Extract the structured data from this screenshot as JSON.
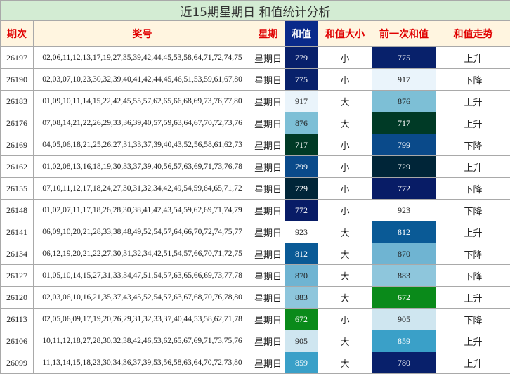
{
  "title": "近15期星期日 和值统计分析",
  "headers": [
    "期次",
    "奖号",
    "星期",
    "和值",
    "和值大小",
    "前一次和值",
    "和值走势"
  ],
  "rows": [
    {
      "period": "26197",
      "numbers": "02,06,11,12,13,17,19,27,35,39,42,44,45,53,58,64,71,72,74,75",
      "weekday": "星期日",
      "sum": "779",
      "sum_color": "#08206b",
      "size": "小",
      "prev": "775",
      "prev_color": "#08216b",
      "trend": "上升"
    },
    {
      "period": "26190",
      "numbers": "02,03,07,10,23,30,32,39,40,41,42,44,45,46,51,53,59,61,67,80",
      "weekday": "星期日",
      "sum": "775",
      "sum_color": "#08216b",
      "size": "小",
      "prev": "917",
      "prev_color": "#eaf4fb",
      "trend": "下降"
    },
    {
      "period": "26183",
      "numbers": "01,09,10,11,14,15,22,42,45,55,57,62,65,66,68,69,73,76,77,80",
      "weekday": "星期日",
      "sum": "917",
      "sum_color": "#eaf4fb",
      "size": "大",
      "prev": "876",
      "prev_color": "#7dbfd6",
      "trend": "上升"
    },
    {
      "period": "26176",
      "numbers": "07,08,14,21,22,26,29,33,36,39,40,57,59,63,64,67,70,72,73,76",
      "weekday": "星期日",
      "sum": "876",
      "sum_color": "#7dbfd6",
      "size": "大",
      "prev": "717",
      "prev_color": "#003a26",
      "trend": "上升"
    },
    {
      "period": "26169",
      "numbers": "04,05,06,18,21,25,26,27,31,33,37,39,40,43,52,56,58,61,62,73",
      "weekday": "星期日",
      "sum": "717",
      "sum_color": "#003a26",
      "size": "小",
      "prev": "799",
      "prev_color": "#0a4a8a",
      "trend": "下降"
    },
    {
      "period": "26162",
      "numbers": "01,02,08,13,16,18,19,30,33,37,39,40,56,57,63,69,71,73,76,78",
      "weekday": "星期日",
      "sum": "799",
      "sum_color": "#0a4a8a",
      "size": "小",
      "prev": "729",
      "prev_color": "#002538",
      "trend": "上升"
    },
    {
      "period": "26155",
      "numbers": "07,10,11,12,17,18,24,27,30,31,32,34,42,49,54,59,64,65,71,72",
      "weekday": "星期日",
      "sum": "729",
      "sum_color": "#002538",
      "size": "小",
      "prev": "772",
      "prev_color": "#081c66",
      "trend": "下降"
    },
    {
      "period": "26148",
      "numbers": "01,02,07,11,17,18,26,28,30,38,41,42,43,54,59,62,69,71,74,79",
      "weekday": "星期日",
      "sum": "772",
      "sum_color": "#081c66",
      "size": "小",
      "prev": "923",
      "prev_color": "#ffffff",
      "trend": "下降"
    },
    {
      "period": "26141",
      "numbers": "06,09,10,20,21,28,33,38,48,49,52,54,57,64,66,70,72,74,75,77",
      "weekday": "星期日",
      "sum": "923",
      "sum_color": "#ffffff",
      "size": "大",
      "prev": "812",
      "prev_color": "#0a5a96",
      "trend": "上升"
    },
    {
      "period": "26134",
      "numbers": "06,12,19,20,21,22,27,30,31,32,34,42,51,54,57,66,70,71,72,75",
      "weekday": "星期日",
      "sum": "812",
      "sum_color": "#0a5a96",
      "size": "大",
      "prev": "870",
      "prev_color": "#6fb4d2",
      "trend": "下降"
    },
    {
      "period": "26127",
      "numbers": "01,05,10,14,15,27,31,33,34,47,51,54,57,63,65,66,69,73,77,78",
      "weekday": "星期日",
      "sum": "870",
      "sum_color": "#6fb4d2",
      "size": "大",
      "prev": "883",
      "prev_color": "#8ec6dc",
      "trend": "下降"
    },
    {
      "period": "26120",
      "numbers": "02,03,06,10,16,21,35,37,43,45,52,54,57,63,67,68,70,76,78,80",
      "weekday": "星期日",
      "sum": "883",
      "sum_color": "#8ec6dc",
      "size": "大",
      "prev": "672",
      "prev_color": "#0a8a1a",
      "trend": "上升"
    },
    {
      "period": "26113",
      "numbers": "02,05,06,09,17,19,20,26,29,31,32,33,37,40,44,53,58,62,71,78",
      "weekday": "星期日",
      "sum": "672",
      "sum_color": "#0a8a1a",
      "size": "小",
      "prev": "905",
      "prev_color": "#cfe6f0",
      "trend": "下降"
    },
    {
      "period": "26106",
      "numbers": "10,11,12,18,27,28,30,32,38,42,46,53,62,65,67,69,71,73,75,76",
      "weekday": "星期日",
      "sum": "905",
      "sum_color": "#cfe6f0",
      "size": "大",
      "prev": "859",
      "prev_color": "#3aa0c8",
      "trend": "上升"
    },
    {
      "period": "26099",
      "numbers": "11,13,14,15,18,23,30,34,36,37,39,53,56,58,63,64,70,72,73,80",
      "weekday": "星期日",
      "sum": "859",
      "sum_color": "#3aa0c8",
      "size": "大",
      "prev": "780",
      "prev_color": "#08206b",
      "trend": "上升"
    }
  ]
}
